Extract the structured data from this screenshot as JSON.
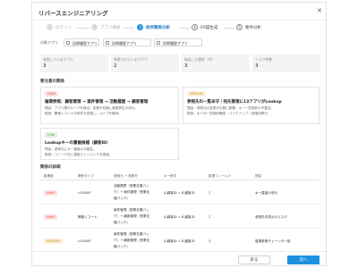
{
  "modal": {
    "title": "リバースエンジニアリング",
    "close_glyph": "×"
  },
  "steps": [
    {
      "num": "1",
      "label": "ログイン",
      "state": "done"
    },
    {
      "num": "2",
      "label": "アプリ選択",
      "state": "done"
    },
    {
      "num": "3",
      "label": "依存関係分析",
      "state": "active"
    },
    {
      "num": "4",
      "label": "ER図生成",
      "state": "future"
    },
    {
      "num": "5",
      "label": "要件分析",
      "state": "future"
    }
  ],
  "filter": {
    "label": "対象アプリ",
    "chips": [
      "訪問履歴アプリ",
      "訪問履歴アプリ",
      "訪問履歴アプリ"
    ]
  },
  "stats": [
    {
      "label": "参照しているアプリ",
      "value": "3"
    },
    {
      "label": "参照されているアプリ",
      "value": "2"
    },
    {
      "label": "検出した関係（件）",
      "value": "3"
    },
    {
      "label": "リスク件数",
      "value": "3"
    }
  ],
  "key_section": {
    "title": "要注意の関係",
    "cards": [
      {
        "badge": "HIGH",
        "level": "high",
        "title": "循環参照：顧客管理 → 案件管理 → 活動履歴 → 顧客管理",
        "lines": [
          "理由：アプリ間のループを検出。変更が伝播し無限再生の恐れ。",
          "推奨：関連レコードの条件を見直し、ループを解消。"
        ]
      },
      {
        "badge": "MEDIUM",
        "level": "medium",
        "title": "参照先の一覧未守｜宛先管理に13アプリがLookup",
        "lines": [
          "理由：参照元の変更が広範に影響。キー一意制約の不整合。",
          "推奨：キーの一意制約確認・バックアップ・段階的移行。"
        ]
      },
      {
        "badge": "LOW",
        "level": "low",
        "title": "Lookupキーの重複候補（顧客ID）",
        "lines": [
          "理由：参照元にキー重複の可能性。",
          "推奨：ユニーク化と重複クレンジングを実施。"
        ]
      }
    ]
  },
  "detail_section": {
    "title": "関係の詳細",
    "headers": [
      "影響度",
      "関係タイプ",
      "参照元 → 参照先",
      "キー条件",
      "影響フィールド",
      "理由"
    ],
    "rows": [
      {
        "level": "high",
        "badge": "HIGH",
        "type": "LOOKUP",
        "ref": [
          "活動履歴（営業支援パッ",
          "ク）→ 案件管理（営業支",
          "援パック）"
        ],
        "key": "A.顧客ID = B.顧客ID",
        "fields": "2",
        "reason": "キー重複の恐れ"
      },
      {
        "level": "high",
        "badge": "HIGH",
        "type": "関連レコード",
        "ref": [
          "案件管理（営業支援パッ",
          "ク）→ 顧客管理（営業支",
          "援パック）"
        ],
        "key": "A.顧客ID = B.顧客ID",
        "fields": "2",
        "reason": "参照先非表示のリスク"
      },
      {
        "level": "medium",
        "badge": "MEDIUM",
        "type": "LOOKUP",
        "ref": [
          "案件管理（営業支援パッ",
          "ク）→ 顧客管理（営業支",
          "援パック）"
        ],
        "key": "A.顧客ID = B.顧客ID",
        "fields": "3",
        "reason": "循環参照チェーンの一部"
      }
    ]
  },
  "footer": {
    "back": "戻る",
    "next": "次へ"
  },
  "colors": {
    "accent": "#1e90e0",
    "high": "#d23c3c",
    "medium": "#c48a18",
    "low": "#3f9a4a"
  }
}
